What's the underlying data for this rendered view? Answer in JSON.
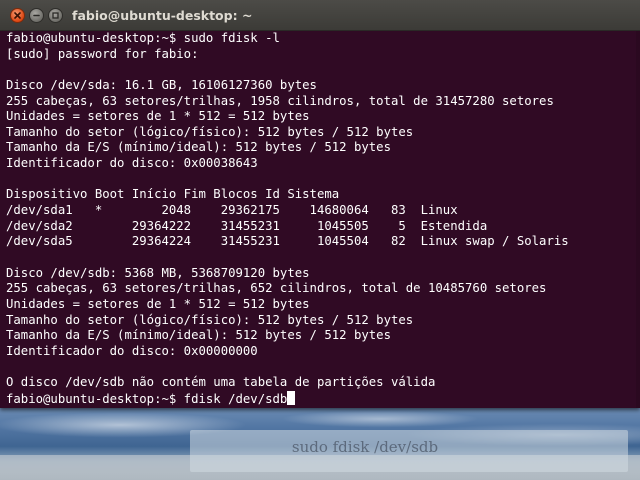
{
  "window": {
    "title": "fabio@ubuntu-desktop: ~"
  },
  "terminal": {
    "lines": [
      "fabio@ubuntu-desktop:~$ sudo fdisk -l",
      "[sudo] password for fabio:",
      "",
      "Disco /dev/sda: 16.1 GB, 16106127360 bytes",
      "255 cabeças, 63 setores/trilhas, 1958 cilindros, total de 31457280 setores",
      "Unidades = setores de 1 * 512 = 512 bytes",
      "Tamanho do setor (lógico/físico): 512 bytes / 512 bytes",
      "Tamanho da E/S (mínimo/ideal): 512 bytes / 512 bytes",
      "Identificador do disco: 0x00038643",
      "",
      "Dispositivo Boot Início Fim Blocos Id Sistema",
      "/dev/sda1   *        2048    29362175    14680064   83  Linux",
      "/dev/sda2        29364222    31455231     1045505    5  Estendida",
      "/dev/sda5        29364224    31455231     1045504   82  Linux swap / Solaris",
      "",
      "Disco /dev/sdb: 5368 MB, 5368709120 bytes",
      "255 cabeças, 63 setores/trilhas, 652 cilindros, total de 10485760 setores",
      "Unidades = setores de 1 * 512 = 512 bytes",
      "Tamanho do setor (lógico/físico): 512 bytes / 512 bytes",
      "Tamanho da E/S (mínimo/ideal): 512 bytes / 512 bytes",
      "Identificador do disco: 0x00000000",
      "",
      "O disco /dev/sdb não contém uma tabela de partições válida"
    ],
    "current_prompt": "fabio@ubuntu-desktop:~$ fdisk /dev/sdb"
  },
  "wallpaper": {
    "caption": "sudo fdisk /dev/sdb"
  },
  "colors": {
    "terminal_background": "#300a24",
    "terminal_text": "#ffffff",
    "titlebar": "#3c3b37",
    "close_button": "#df4a16"
  },
  "icons": {
    "close": "close-icon",
    "minimize": "minimize-icon",
    "maximize": "maximize-icon"
  }
}
